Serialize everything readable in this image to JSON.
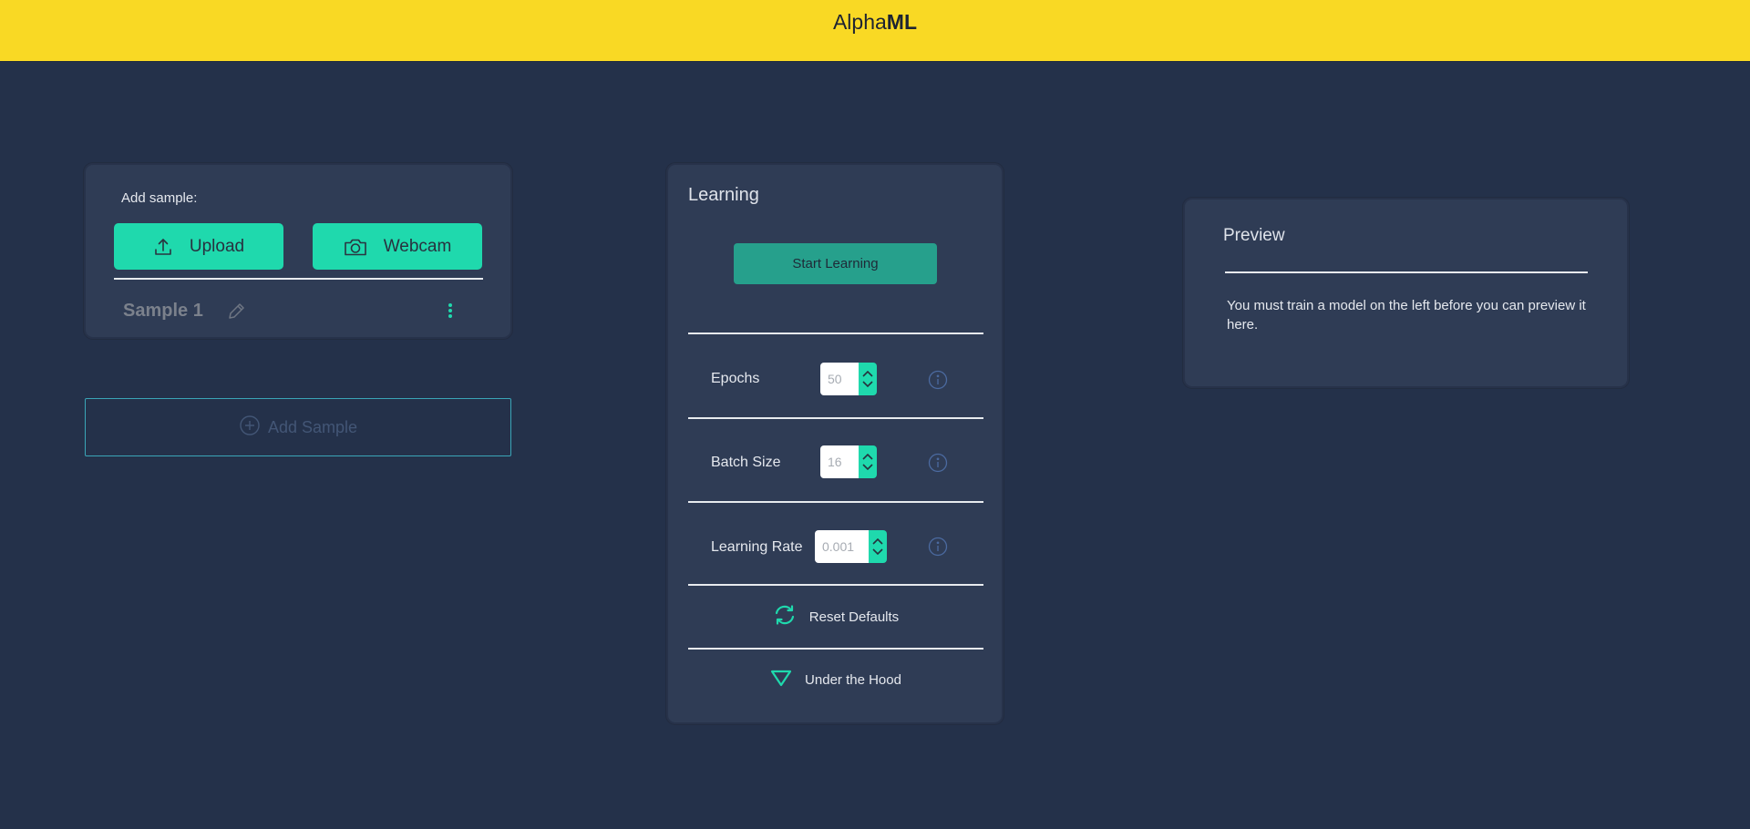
{
  "app": {
    "brand_regular": "Alpha",
    "brand_bold": "ML"
  },
  "sample_card": {
    "add_sample_label": "Add sample:",
    "upload_label": "Upload",
    "webcam_label": "Webcam",
    "sample_name": "Sample 1"
  },
  "add_sample_button": {
    "label": "Add Sample"
  },
  "learning": {
    "title": "Learning",
    "start_button": "Start Learning",
    "params": [
      {
        "label": "Epochs",
        "value": "50"
      },
      {
        "label": "Batch Size",
        "value": "16"
      },
      {
        "label": "Learning Rate",
        "value": "0.001"
      }
    ],
    "reset_label": "Reset Defaults",
    "hood_label": "Under the Hood"
  },
  "preview": {
    "title": "Preview",
    "message": "You must train a model on the left before you can preview it here."
  },
  "colors": {
    "topbar": "#f9d924",
    "background": "#24314a",
    "card": "#2f3c55",
    "accent": "#1fd9ad",
    "start_button": "#26a08c"
  }
}
